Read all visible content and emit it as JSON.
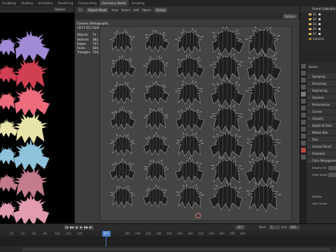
{
  "top_menu": {
    "items": [
      "Sculpting",
      "Shading",
      "Animation",
      "Rendering",
      "Compositing",
      "Geometry Nodes",
      "Scripting"
    ]
  },
  "left_panel": {
    "options_label": "Options",
    "hair_colors": [
      "#a18bd6",
      "#d13f52",
      "#ec6b7d",
      "#e8e3a8",
      "#8fc3dc",
      "#c47b8c",
      "#e29cb0"
    ]
  },
  "viewport": {
    "header": {
      "mode_label": "Object Mode",
      "menus": [
        "View",
        "Select",
        "Add",
        "Object"
      ],
      "orientation_label": "Global",
      "options_label": "Options"
    },
    "overlay": {
      "view_name": "Camera Orthographic",
      "collection_line": "(317) 03 | Camera",
      "stats": [
        {
          "label": "Objects",
          "value": "71"
        },
        {
          "label": "Vertices",
          "value": "382,464"
        },
        {
          "label": "Edges",
          "value": "747,239"
        },
        {
          "label": "Faces",
          "value": "364,173"
        },
        {
          "label": "Triangles",
          "value": "724,998"
        }
      ]
    }
  },
  "outliner": {
    "title": "Scene Collection",
    "items": [
      {
        "label": "01"
      },
      {
        "label": "02"
      },
      {
        "label": "03"
      },
      {
        "label": "05"
      },
      {
        "label": "07"
      },
      {
        "label": "Camera"
      }
    ]
  },
  "properties": {
    "scene_label": "Scene",
    "sections": [
      {
        "label": "Sampling"
      },
      {
        "label": "Denoising"
      },
      {
        "label": "Raytracing"
      },
      {
        "label": "Volumes"
      },
      {
        "label": "Performance"
      },
      {
        "label": "Curves"
      },
      {
        "label": "Simplify"
      },
      {
        "label": "Depth of Field"
      },
      {
        "label": "Motion Blur"
      },
      {
        "label": "Film"
      },
      {
        "label": "Grease Pencil"
      },
      {
        "label": "Freestyle"
      },
      {
        "label": "Color Management"
      }
    ],
    "sub_rows": [
      "Display De",
      "View Transf",
      "Display",
      "Use Curves"
    ]
  },
  "timeline": {
    "current_frame": "317",
    "start_label": "Start",
    "start_value": "1",
    "end_label": "End",
    "end_value": "420",
    "ruler_ticks": [
      "0",
      "20",
      "40",
      "60",
      "80",
      "100",
      "120",
      "140",
      "180",
      "200",
      "220",
      "240",
      "260",
      "280",
      "300",
      "320",
      "340",
      "360",
      "380",
      "400"
    ],
    "controls": [
      "|◀",
      "◀◀",
      "◀",
      "▶",
      "▶▶",
      "▶|"
    ]
  }
}
